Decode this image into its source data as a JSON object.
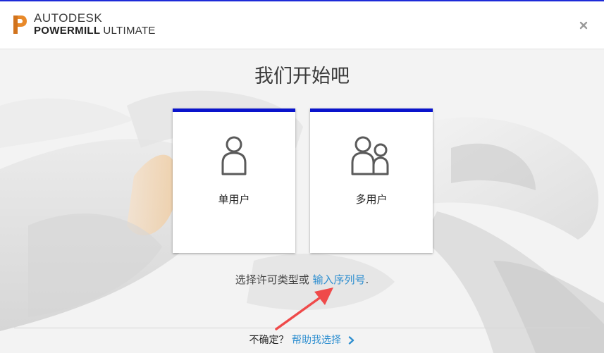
{
  "header": {
    "brand_top": "AUTODESK",
    "brand_product": "POWERMILL",
    "brand_edition": "ULTIMATE",
    "brand_mark_glyph": "P"
  },
  "main": {
    "title": "我们开始吧",
    "options": [
      {
        "label": "单用户",
        "icon": "single-user-icon"
      },
      {
        "label": "多用户",
        "icon": "multi-user-icon"
      }
    ],
    "hint_prefix": "选择许可类型或 ",
    "hint_link": "输入序列号",
    "hint_suffix": "."
  },
  "footer": {
    "question": "不确定？",
    "help_link": "帮助我选择",
    "chevron_icon": "chevron-right-icon"
  },
  "colors": {
    "card_accent": "#0a14cc",
    "link": "#2f8fd0",
    "logo_orange": "#e8892a",
    "annotation_arrow": "#ef4a4a"
  }
}
